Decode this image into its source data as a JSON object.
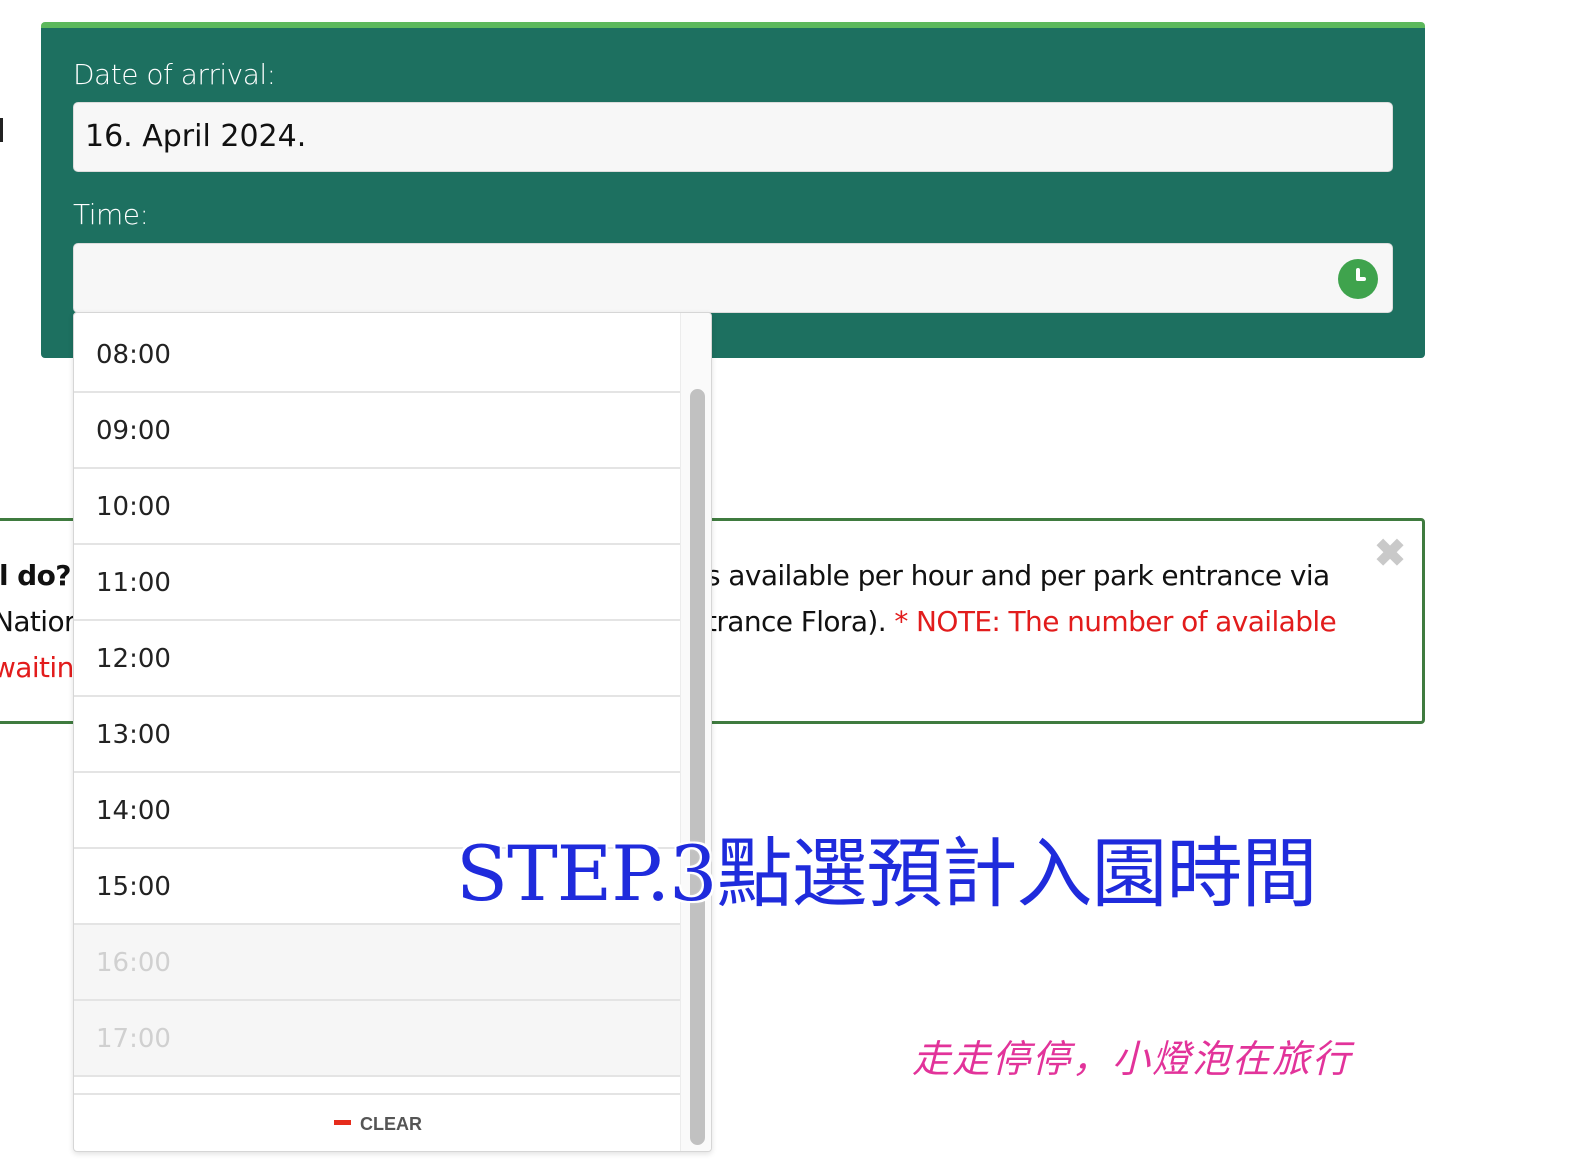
{
  "form": {
    "date_label": "Date of arrival:",
    "date_value": "16. April 2024.",
    "time_label": "Time:",
    "time_value": ""
  },
  "info": {
    "left_question": "l do?",
    "left_line2": "Natior",
    "left_line3": "waitin",
    "right_line1": "s available per hour and per park entrance via",
    "right_line2_a": "trance Flora). ",
    "right_line2_b": "* NOTE: The number of available",
    "close_glyph": "✖"
  },
  "time_options": [
    {
      "label": "08:00",
      "disabled": false
    },
    {
      "label": "09:00",
      "disabled": false
    },
    {
      "label": "10:00",
      "disabled": false
    },
    {
      "label": "11:00",
      "disabled": false
    },
    {
      "label": "12:00",
      "disabled": false
    },
    {
      "label": "13:00",
      "disabled": false
    },
    {
      "label": "14:00",
      "disabled": false
    },
    {
      "label": "15:00",
      "disabled": false
    },
    {
      "label": "16:00",
      "disabled": true
    },
    {
      "label": "17:00",
      "disabled": true
    }
  ],
  "clear_label": "CLEAR",
  "caption": "STEP.3點選預計入園時間",
  "watermark": "走走停停，小燈泡在旅行",
  "colors": {
    "panel": "#1d7060",
    "panel_top": "#5cb85c",
    "clock": "#3fa34d",
    "clear_icon": "#e62c1c",
    "note_red": "#e21c1c",
    "caption": "#1f2bdc",
    "watermark": "#e2339a"
  },
  "icons": [
    "clock-icon",
    "close-icon",
    "minus-icon"
  ]
}
